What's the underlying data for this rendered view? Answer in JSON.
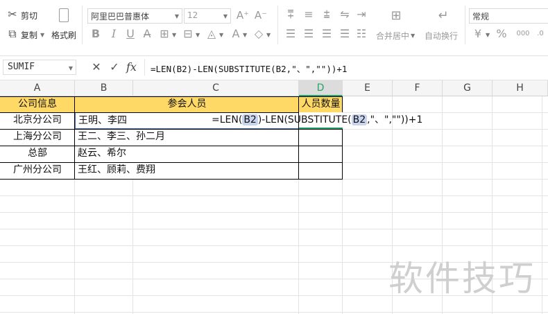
{
  "toolbar": {
    "cut_label": "剪切",
    "copy_label": "复制",
    "format_painter_label": "格式刷",
    "font_name": "阿里巴巴普惠体",
    "font_size": "12",
    "merge_label": "合并居中",
    "wrap_label": "自动换行",
    "number_format": "常规",
    "bold": "B",
    "italic": "I",
    "underline": "U",
    "font_color_glyph": "A",
    "increase_font": "A⁺",
    "decrease_font": "A⁻",
    "currency": "¥",
    "percent": "%",
    "thousands": "000"
  },
  "formula_bar": {
    "name_box": "SUMIF",
    "fx": "fx",
    "formula": "=LEN(B2)-LEN(SUBSTITUTE(B2,\"、\",\"\"))+1"
  },
  "columns": [
    "A",
    "B",
    "C",
    "D",
    "E",
    "F",
    "G",
    "H"
  ],
  "headers": {
    "a1": "公司信息",
    "bc1": "参会人员",
    "d1": "人员数量"
  },
  "rows": [
    {
      "company": "北京分公司",
      "members": "王明、李四"
    },
    {
      "company": "上海分公司",
      "members": "王二、李三、孙二月"
    },
    {
      "company": "总部",
      "members": "赵云、希尔"
    },
    {
      "company": "广州分公司",
      "members": "王红、顾莉、费翔"
    }
  ],
  "edit": {
    "p1": "=LEN(",
    "r1": "B2",
    "p2": ")-LEN(SUBSTITUTE(",
    "r2": "B2",
    "p3": ",\"、\",\"\"))+1"
  },
  "watermark": "软件技巧",
  "colors": {
    "header_fill": "#ffd966",
    "selected_col": "#21a366",
    "ref_highlight": "#c8d4ee",
    "edit_border": "#4472c4"
  }
}
